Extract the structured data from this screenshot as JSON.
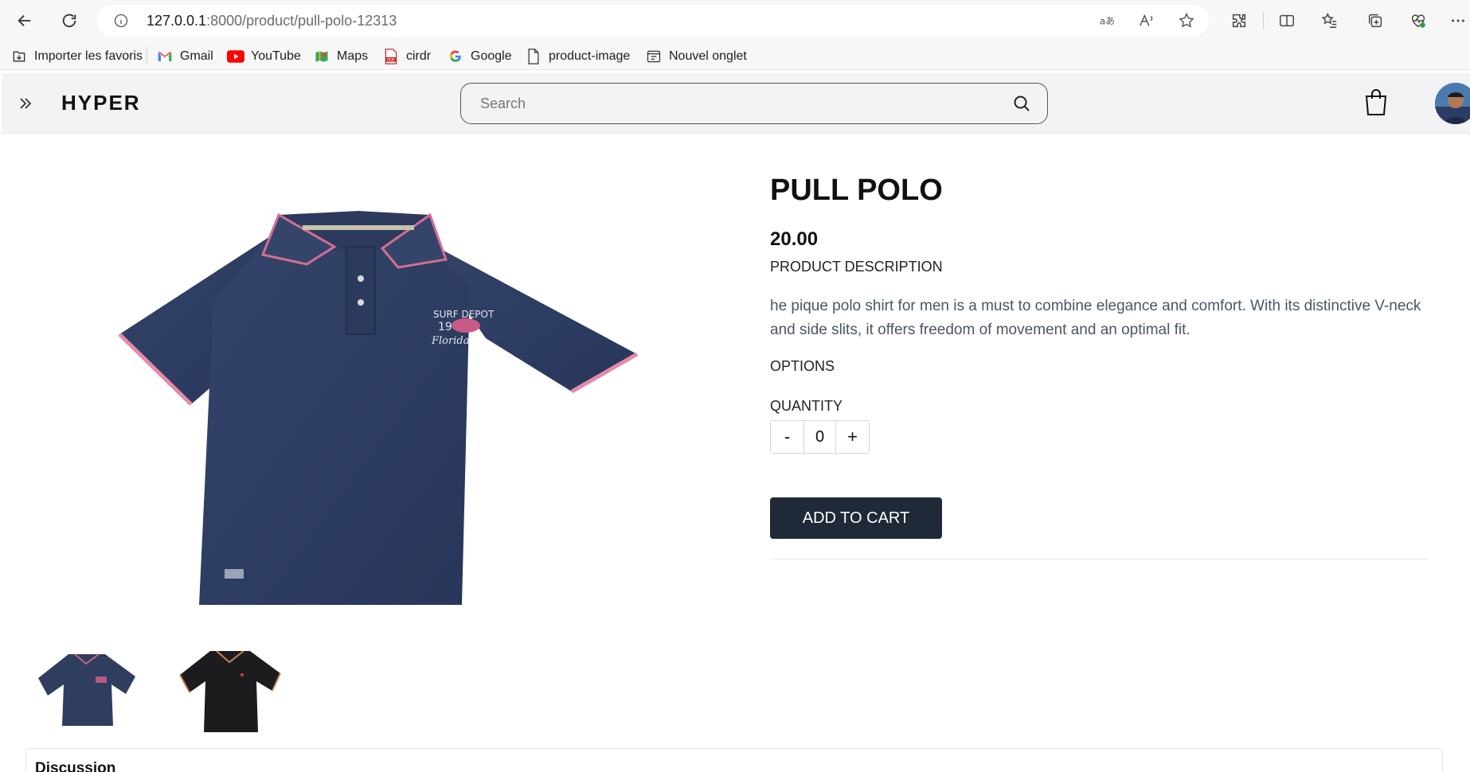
{
  "browser": {
    "url_host": "127.0.0.1",
    "url_path": ":8000/product/pull-polo-12313",
    "bookmarks": [
      {
        "label": "Importer les favoris",
        "icon": "import-favorites-icon"
      },
      {
        "label": "Gmail",
        "icon": "gmail-icon"
      },
      {
        "label": "YouTube",
        "icon": "youtube-icon"
      },
      {
        "label": "Maps",
        "icon": "maps-icon"
      },
      {
        "label": "cirdr",
        "icon": "pdf-icon"
      },
      {
        "label": "Google",
        "icon": "google-icon"
      },
      {
        "label": "product-image",
        "icon": "page-icon"
      },
      {
        "label": "Nouvel onglet",
        "icon": "new-tab-icon"
      }
    ]
  },
  "header": {
    "brand": "HYPER",
    "search_placeholder": "Search"
  },
  "product": {
    "title": "PULL POLO",
    "price": "20.00",
    "description_label": "PRODUCT DESCRIPTION",
    "description": "he pique polo shirt for men is a must to combine elegance and comfort. With its distinctive V-neck and side slits, it offers freedom of movement and an optimal fit.",
    "options_label": "OPTIONS",
    "quantity_label": "QUANTITY",
    "quantity_value": "0",
    "minus_label": "-",
    "plus_label": "+",
    "add_to_cart_label": "ADD TO CART",
    "colors": {
      "navy": "#2f3d5e",
      "black": "#1c1c1f",
      "accent": "#1f2937"
    }
  },
  "discussion": {
    "title": "Discussion"
  }
}
